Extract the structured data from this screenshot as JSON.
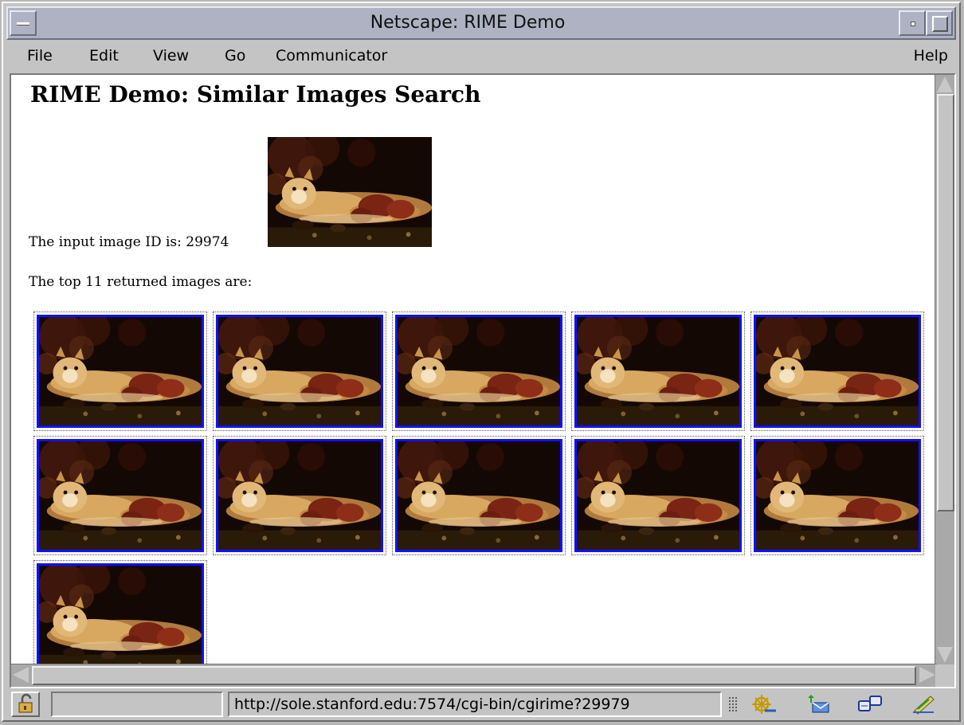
{
  "window": {
    "title": "Netscape: RIME Demo"
  },
  "menubar": {
    "items": [
      "File",
      "Edit",
      "View",
      "Go",
      "Communicator"
    ],
    "help": "Help"
  },
  "page": {
    "heading": "RIME Demo: Similar Images Search",
    "input_label": "The input image ID is: 29974",
    "results_label": "The top 11 returned images are:",
    "result_count": 11
  },
  "statusbar": {
    "url": "http://sole.stanford.edu:7574/cgi-bin/cgirime?29979",
    "status_text": ""
  },
  "colors": {
    "thumb_border": "#1010ff",
    "titlebar": "#aeb2c3",
    "chrome": "#c4c4c4"
  },
  "icons": [
    "security-lock-icon",
    "navigator-helm-icon",
    "mail-icon",
    "discussion-icon",
    "composer-pen-icon"
  ]
}
